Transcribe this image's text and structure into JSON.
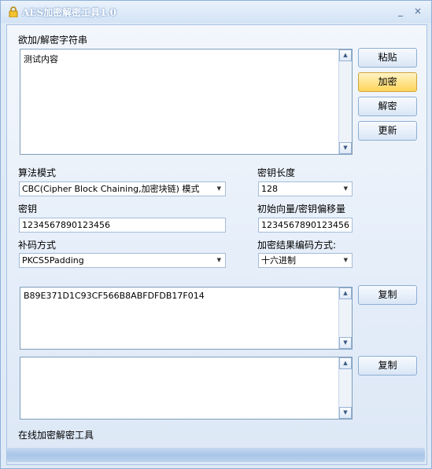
{
  "window": {
    "title": "AES加密解密工具1.0",
    "minimize_symbol": "_",
    "close_symbol": "×",
    "icon": "lock-icon"
  },
  "input_section": {
    "label": "欲加/解密字符串",
    "value": "测试内容"
  },
  "buttons": {
    "paste": "粘贴",
    "encrypt": "加密",
    "decrypt": "解密",
    "refresh": "更新",
    "copy1": "复制",
    "copy2": "复制"
  },
  "algorithm": {
    "label": "算法模式",
    "selected": "CBC(Cipher Block Chaining,加密块链) 模式"
  },
  "key_length": {
    "label": "密钥长度",
    "selected": "128"
  },
  "key": {
    "label": "密钥",
    "value": "1234567890123456"
  },
  "iv": {
    "label": "初始向量/密钥偏移量",
    "value": "1234567890123456"
  },
  "padding": {
    "label": "补码方式",
    "selected": "PKCS5Padding"
  },
  "encoding": {
    "label": "加密结果编码方式:",
    "selected": "十六进制"
  },
  "output1": {
    "value": "B89E371D1C93CF566B8ABFDFDB17F014"
  },
  "output2": {
    "value": ""
  },
  "footer": {
    "text": "在线加密解密工具"
  },
  "colors": {
    "accent_button": "#ffd55a",
    "window_bg": "#dfeaf7",
    "title_text": "#ffffff"
  }
}
